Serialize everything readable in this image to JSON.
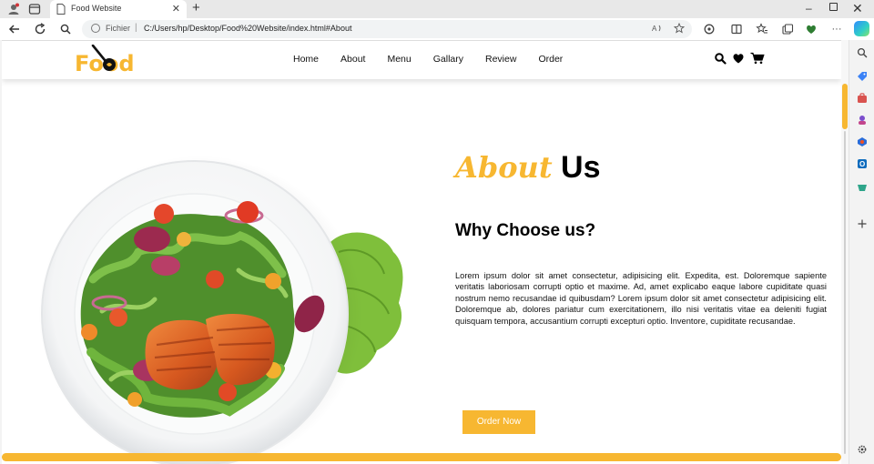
{
  "browser": {
    "tab_title": "Food Website",
    "tab_close": "✕",
    "new_tab": "+",
    "win_min": "–",
    "win_close": "✕",
    "address": {
      "scheme_label": "Fichier",
      "separator": "|",
      "url": "C:/Users/hp/Desktop/Food%20Website/index.html#About"
    },
    "icons": [
      "back-icon",
      "refresh-icon",
      "search-icon",
      "read-aloud-icon",
      "favorite-star-icon",
      "extensions-icon",
      "split-screen-icon",
      "favorites-icon",
      "collections-icon",
      "browser-essentials-icon",
      "more-icon",
      "copilot-icon"
    ]
  },
  "site": {
    "logo": "Food",
    "nav": [
      "Home",
      "About",
      "Menu",
      "Gallary",
      "Review",
      "Order"
    ],
    "header_icons": [
      "search-icon",
      "heart-icon",
      "cart-icon"
    ]
  },
  "about": {
    "title_accent": "About",
    "title_rest": "Us",
    "heading": "Why Choose us?",
    "description": "Lorem ipsum dolor sit amet consectetur, adipisicing elit. Expedita, est. Doloremque sapiente veritatis laboriosam corrupti optio et maxime. Ad, amet explicabo eaque labore cupiditate quasi nostrum nemo recusandae id quibusdam? Lorem ipsum dolor sit amet consectetur adipisicing elit. Doloremque ab, dolores pariatur cum exercitationem, illo nisi veritatis vitae ea deleniti fugiat quisquam tempora, accusantium corrupti excepturi optio. Inventore, cupiditate recusandae.",
    "button": "Order Now"
  },
  "colors": {
    "accent": "#f7b731",
    "text": "#111111",
    "background": "#ffffff"
  }
}
